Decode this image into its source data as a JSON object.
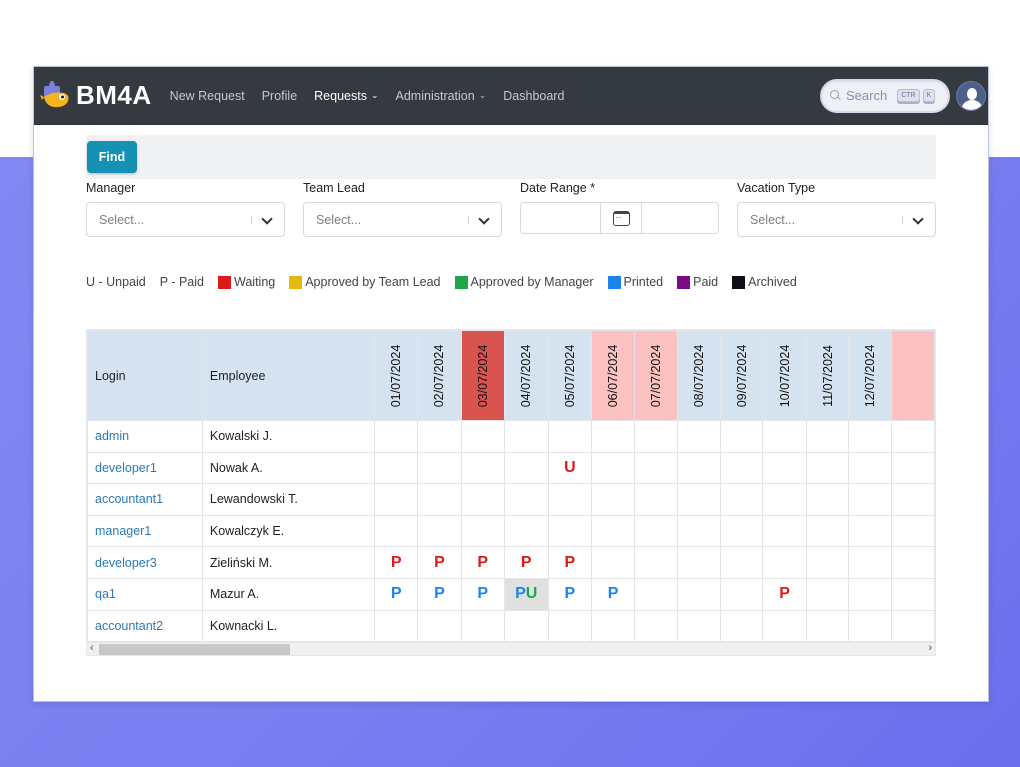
{
  "navbar": {
    "brand": "BM4A",
    "links": [
      {
        "label": "New Request",
        "active": false,
        "dropdown": false
      },
      {
        "label": "Profile",
        "active": false,
        "dropdown": false
      },
      {
        "label": "Requests",
        "active": true,
        "dropdown": true
      },
      {
        "label": "Administration",
        "active": false,
        "dropdown": true
      },
      {
        "label": "Dashboard",
        "active": false,
        "dropdown": false
      }
    ],
    "search": {
      "label": "Search",
      "shortcut_keys": [
        "CTR",
        "K"
      ]
    },
    "icons": {
      "logo": "puzzle-bird-logo-icon",
      "search": "search-icon",
      "avatar": "user-avatar-icon",
      "dropdown": "chevron-down-icon"
    }
  },
  "filters": {
    "find_label": "Find",
    "manager": {
      "label": "Manager",
      "placeholder": "Select..."
    },
    "team_lead": {
      "label": "Team Lead",
      "placeholder": "Select..."
    },
    "date_range": {
      "label": "Date Range *",
      "start": "",
      "end": "",
      "icon": "calendar-icon"
    },
    "vacation_type": {
      "label": "Vacation Type",
      "placeholder": "Select..."
    }
  },
  "legend": {
    "unpaid": "U - Unpaid",
    "paid": "P - Paid",
    "statuses": [
      {
        "label": "Waiting",
        "color": "#dc1a1a"
      },
      {
        "label": "Approved by Team Lead",
        "color": "#e5b80b"
      },
      {
        "label": "Approved by Manager",
        "color": "#1fa64b"
      },
      {
        "label": "Printed",
        "color": "#1a85ee"
      },
      {
        "label": "Paid",
        "color": "#7d0b87"
      },
      {
        "label": "Archived",
        "color": "#0d1117"
      }
    ]
  },
  "table": {
    "headers": {
      "login": "Login",
      "employee": "Employee"
    },
    "dates": [
      {
        "label": "01/07/2024",
        "kind": "normal"
      },
      {
        "label": "02/07/2024",
        "kind": "normal"
      },
      {
        "label": "03/07/2024",
        "kind": "today"
      },
      {
        "label": "04/07/2024",
        "kind": "normal"
      },
      {
        "label": "05/07/2024",
        "kind": "normal"
      },
      {
        "label": "06/07/2024",
        "kind": "weekend"
      },
      {
        "label": "07/07/2024",
        "kind": "weekend"
      },
      {
        "label": "08/07/2024",
        "kind": "normal"
      },
      {
        "label": "09/07/2024",
        "kind": "normal"
      },
      {
        "label": "10/07/2024",
        "kind": "normal"
      },
      {
        "label": "11/07/2024",
        "kind": "normal"
      },
      {
        "label": "12/07/2024",
        "kind": "normal"
      },
      {
        "label": "",
        "kind": "weekend"
      }
    ],
    "rows": [
      {
        "login": "admin",
        "employee": "Kowalski J.",
        "cells": {}
      },
      {
        "login": "developer1",
        "employee": "Nowak A.",
        "cells": {
          "4": [
            {
              "t": "U",
              "c": "red"
            }
          ]
        }
      },
      {
        "login": "accountant1",
        "employee": "Lewandowski T.",
        "cells": {}
      },
      {
        "login": "manager1",
        "employee": "Kowalczyk E.",
        "cells": {}
      },
      {
        "login": "developer3",
        "employee": "Zieliński M.",
        "cells": {
          "0": [
            {
              "t": "P",
              "c": "red"
            }
          ],
          "1": [
            {
              "t": "P",
              "c": "red"
            }
          ],
          "2": [
            {
              "t": "P",
              "c": "red"
            }
          ],
          "3": [
            {
              "t": "P",
              "c": "red"
            }
          ],
          "4": [
            {
              "t": "P",
              "c": "red"
            }
          ]
        }
      },
      {
        "login": "qa1",
        "employee": "Mazur A.",
        "cells": {
          "0": [
            {
              "t": "P",
              "c": "blue"
            }
          ],
          "1": [
            {
              "t": "P",
              "c": "blue"
            }
          ],
          "2": [
            {
              "t": "P",
              "c": "blue"
            }
          ],
          "3": [
            {
              "t": "P",
              "c": "blue"
            },
            {
              "t": "U",
              "c": "green"
            }
          ],
          "4": [
            {
              "t": "P",
              "c": "blue"
            }
          ],
          "5": [
            {
              "t": "P",
              "c": "blue"
            }
          ],
          "9": [
            {
              "t": "P",
              "c": "red"
            }
          ]
        },
        "shaded": [
          3
        ]
      },
      {
        "login": "accountant2",
        "employee": "Kownacki L.",
        "cells": {}
      }
    ]
  }
}
